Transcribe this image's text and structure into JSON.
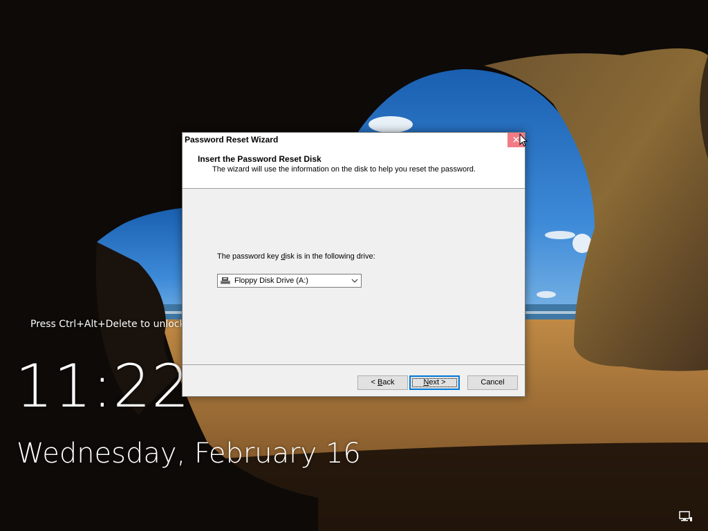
{
  "lock_screen": {
    "unlock_hint": "Press Ctrl+Alt+Delete to unlock.",
    "time": "11:22",
    "date": "Wednesday, February 16",
    "network_icon": "network-icon"
  },
  "wizard": {
    "title": "Password Reset Wizard",
    "close_icon": "close-icon",
    "header_title": "Insert the Password Reset Disk",
    "header_subtitle": "The wizard will use the information on the disk to help you reset the password.",
    "drive_label_pre": "The password key ",
    "drive_label_key": "d",
    "drive_label_post": "isk is in the following drive:",
    "drive_select": {
      "value": "Floppy Disk Drive (A:)",
      "icon": "floppy-drive-icon"
    },
    "buttons": {
      "back_prefix": "< ",
      "back_key": "B",
      "back_suffix": "ack",
      "next_key": "N",
      "next_suffix": "ext >",
      "cancel": "Cancel"
    }
  },
  "colors": {
    "dialog_bg": "#f0f0f0",
    "header_bg": "#ffffff",
    "focus_border": "#0078d7",
    "close_hover": "#e81123"
  }
}
